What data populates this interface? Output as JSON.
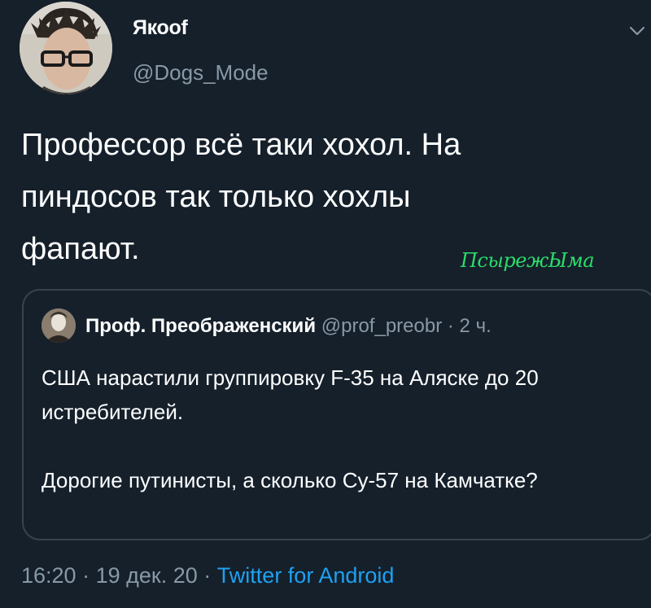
{
  "author": {
    "display_name": "Якоof",
    "handle": "@Dogs_Mode"
  },
  "tweet": {
    "lines": [
      "Профессор всё таки хохол. На",
      "пиндосов так только хохлы",
      "фапают."
    ]
  },
  "watermark": "ПсырежЫма",
  "quoted_tweet": {
    "display_name": "Проф. Преображенский",
    "handle": "@prof_preobr",
    "separator": "·",
    "time": "2 ч.",
    "paragraphs": [
      "США нарастили группировку F-35 на Аляске до 20 истребителей.",
      "Дорогие путинисты, а сколько Су-57 на Камчатке?"
    ]
  },
  "meta": {
    "time": "16:20",
    "separator": "·",
    "date": "19 дек. 20",
    "source": "Twitter for Android"
  },
  "icons": {
    "menu": "chevron-down-icon"
  },
  "colors": {
    "background": "#15202b",
    "secondary_text": "#8899a6",
    "link": "#1da1f2",
    "border": "#38444d",
    "watermark": "#2bdc6b"
  }
}
